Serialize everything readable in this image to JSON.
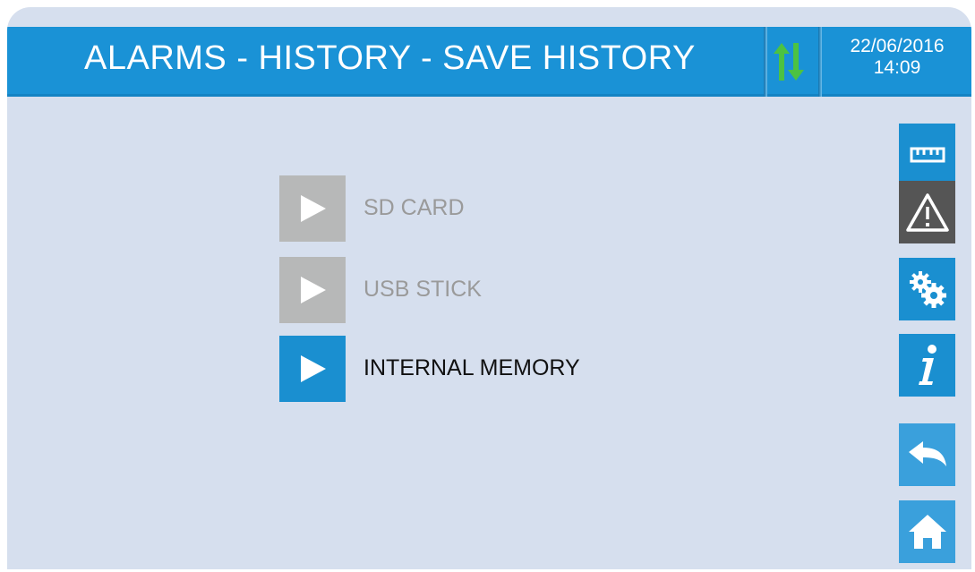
{
  "header": {
    "title": "ALARMS - HISTORY - SAVE HISTORY",
    "date": "22/06/2016",
    "time": "14:09",
    "status_icon": "transfer-arrows-icon"
  },
  "menu": {
    "items": [
      {
        "label": "SD CARD",
        "enabled": false,
        "icon": "play-icon"
      },
      {
        "label": "USB STICK",
        "enabled": false,
        "icon": "play-icon"
      },
      {
        "label": "INTERNAL MEMORY",
        "enabled": true,
        "icon": "play-icon"
      }
    ]
  },
  "sidebar": {
    "buttons": [
      {
        "name": "ruler-icon"
      },
      {
        "name": "warning-icon"
      },
      {
        "name": "settings-gears-icon"
      },
      {
        "name": "info-icon"
      },
      {
        "name": "back-arrow-icon"
      },
      {
        "name": "home-icon"
      }
    ]
  },
  "colors": {
    "header_blue": "#1a92d6",
    "background": "#d6dfee",
    "disabled_gray": "#b7b8b8",
    "arrow_green": "#4cc242"
  }
}
